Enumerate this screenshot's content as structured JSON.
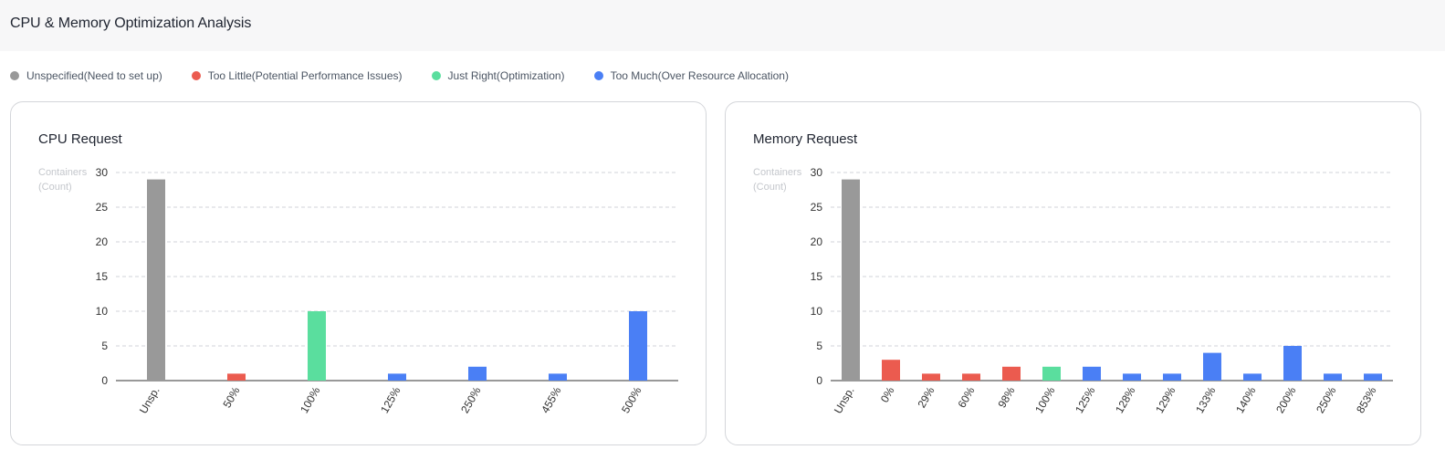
{
  "header": {
    "title": "CPU & Memory Optimization Analysis"
  },
  "colors": {
    "unspecified": "#999999",
    "too_little": "#eb5b4f",
    "just_right": "#5ade9e",
    "too_much": "#4a7ff5"
  },
  "legend": [
    {
      "label": "Unspecified(Need to set up)",
      "color": "#999999"
    },
    {
      "label": "Too Little(Potential Performance Issues)",
      "color": "#eb5b4f"
    },
    {
      "label": "Just Right(Optimization)",
      "color": "#5ade9e"
    },
    {
      "label": "Too Much(Over Resource Allocation)",
      "color": "#4a7ff5"
    }
  ],
  "chart_data": [
    {
      "type": "bar",
      "title": "CPU Request",
      "ylabel_line1": "Containers",
      "ylabel_line2": "(Count)",
      "ylim": [
        0,
        30
      ],
      "yticks": [
        0,
        5,
        10,
        15,
        20,
        25,
        30
      ],
      "grid": true,
      "categories": [
        "Unsp.",
        "50%",
        "100%",
        "125%",
        "250%",
        "455%",
        "500%"
      ],
      "values": [
        29,
        1,
        10,
        1,
        2,
        1,
        10
      ],
      "status": [
        "unspecified",
        "too_little",
        "just_right",
        "too_much",
        "too_much",
        "too_much",
        "too_much"
      ]
    },
    {
      "type": "bar",
      "title": "Memory Request",
      "ylabel_line1": "Containers",
      "ylabel_line2": "(Count)",
      "ylim": [
        0,
        30
      ],
      "yticks": [
        0,
        5,
        10,
        15,
        20,
        25,
        30
      ],
      "grid": true,
      "categories": [
        "Unsp.",
        "0%",
        "29%",
        "60%",
        "98%",
        "100%",
        "125%",
        "128%",
        "129%",
        "133%",
        "140%",
        "200%",
        "250%",
        "853%"
      ],
      "values": [
        29,
        3,
        1,
        1,
        2,
        2,
        2,
        1,
        1,
        4,
        1,
        5,
        1,
        1
      ],
      "status": [
        "unspecified",
        "too_little",
        "too_little",
        "too_little",
        "too_little",
        "just_right",
        "too_much",
        "too_much",
        "too_much",
        "too_much",
        "too_much",
        "too_much",
        "too_much",
        "too_much"
      ]
    }
  ]
}
